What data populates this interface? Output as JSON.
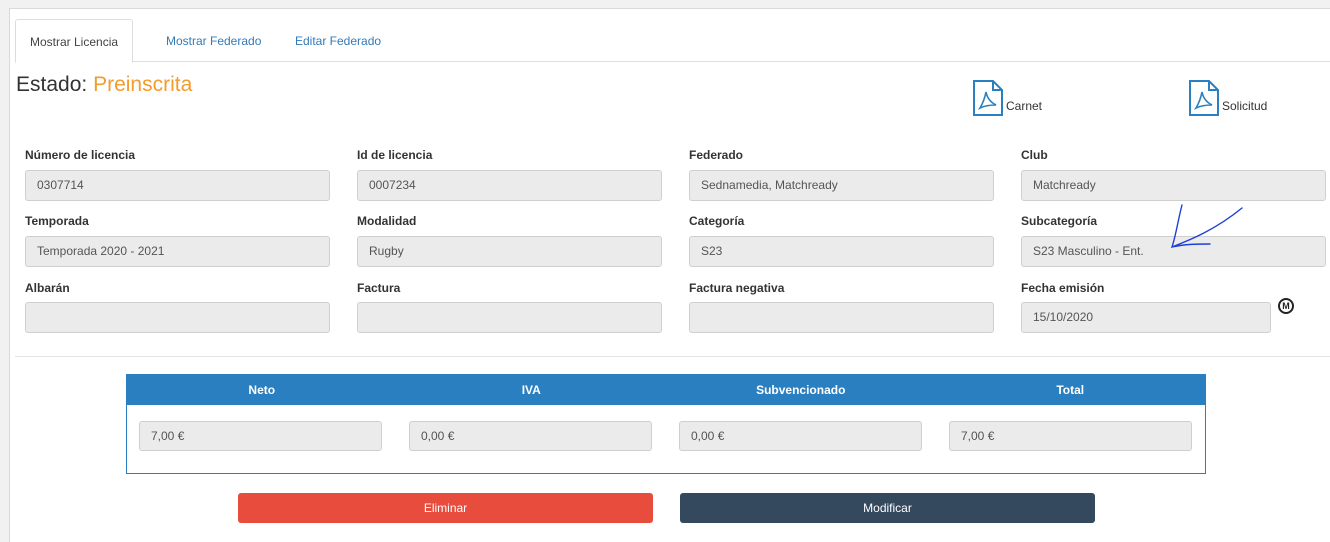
{
  "tabs": [
    {
      "label": "Mostrar Licencia",
      "active": true
    },
    {
      "label": "Mostrar Federado",
      "active": false
    },
    {
      "label": "Editar Federado",
      "active": false
    }
  ],
  "estado": {
    "label": "Estado: ",
    "value": "Preinscrita",
    "value_color": "#f49b2d"
  },
  "documents": {
    "carnet": {
      "label": "Carnet",
      "icon": "pdf-icon"
    },
    "solicitud": {
      "label": "Solicitud",
      "icon": "pdf-icon"
    }
  },
  "fields": {
    "numero_licencia": {
      "label": "Número de licencia",
      "value": "0307714"
    },
    "id_licencia": {
      "label": "Id de licencia",
      "value": "0007234"
    },
    "federado": {
      "label": "Federado",
      "value": "Sednamedia, Matchready"
    },
    "club": {
      "label": "Club",
      "value": "Matchready"
    },
    "temporada": {
      "label": "Temporada",
      "value": "Temporada 2020 - 2021"
    },
    "modalidad": {
      "label": "Modalidad",
      "value": "Rugby"
    },
    "categoria": {
      "label": "Categoría",
      "value": "S23"
    },
    "subcategoria": {
      "label": "Subcategoría",
      "value": "S23 Masculino - Ent."
    },
    "albaran": {
      "label": "Albarán",
      "value": ""
    },
    "factura": {
      "label": "Factura",
      "value": ""
    },
    "factura_negativa": {
      "label": "Factura negativa",
      "value": ""
    },
    "fecha_emision": {
      "label": "Fecha emisión",
      "value": "15/10/2020",
      "icon": "m-circle-icon",
      "icon_text": "M"
    }
  },
  "amounts": {
    "headers": [
      "Neto",
      "IVA",
      "Subvencionado",
      "Total"
    ],
    "values": [
      "7,00 €",
      "0,00 €",
      "0,00 €",
      "7,00 €"
    ],
    "header_color": "#2a7fc1"
  },
  "buttons": {
    "eliminar": {
      "label": "Eliminar",
      "color": "#e74c3c"
    },
    "modificar": {
      "label": "Modificar",
      "color": "#34495e"
    }
  },
  "annotation": {
    "icon": "handwritten-scribble-icon",
    "color": "#1f3fd6"
  }
}
